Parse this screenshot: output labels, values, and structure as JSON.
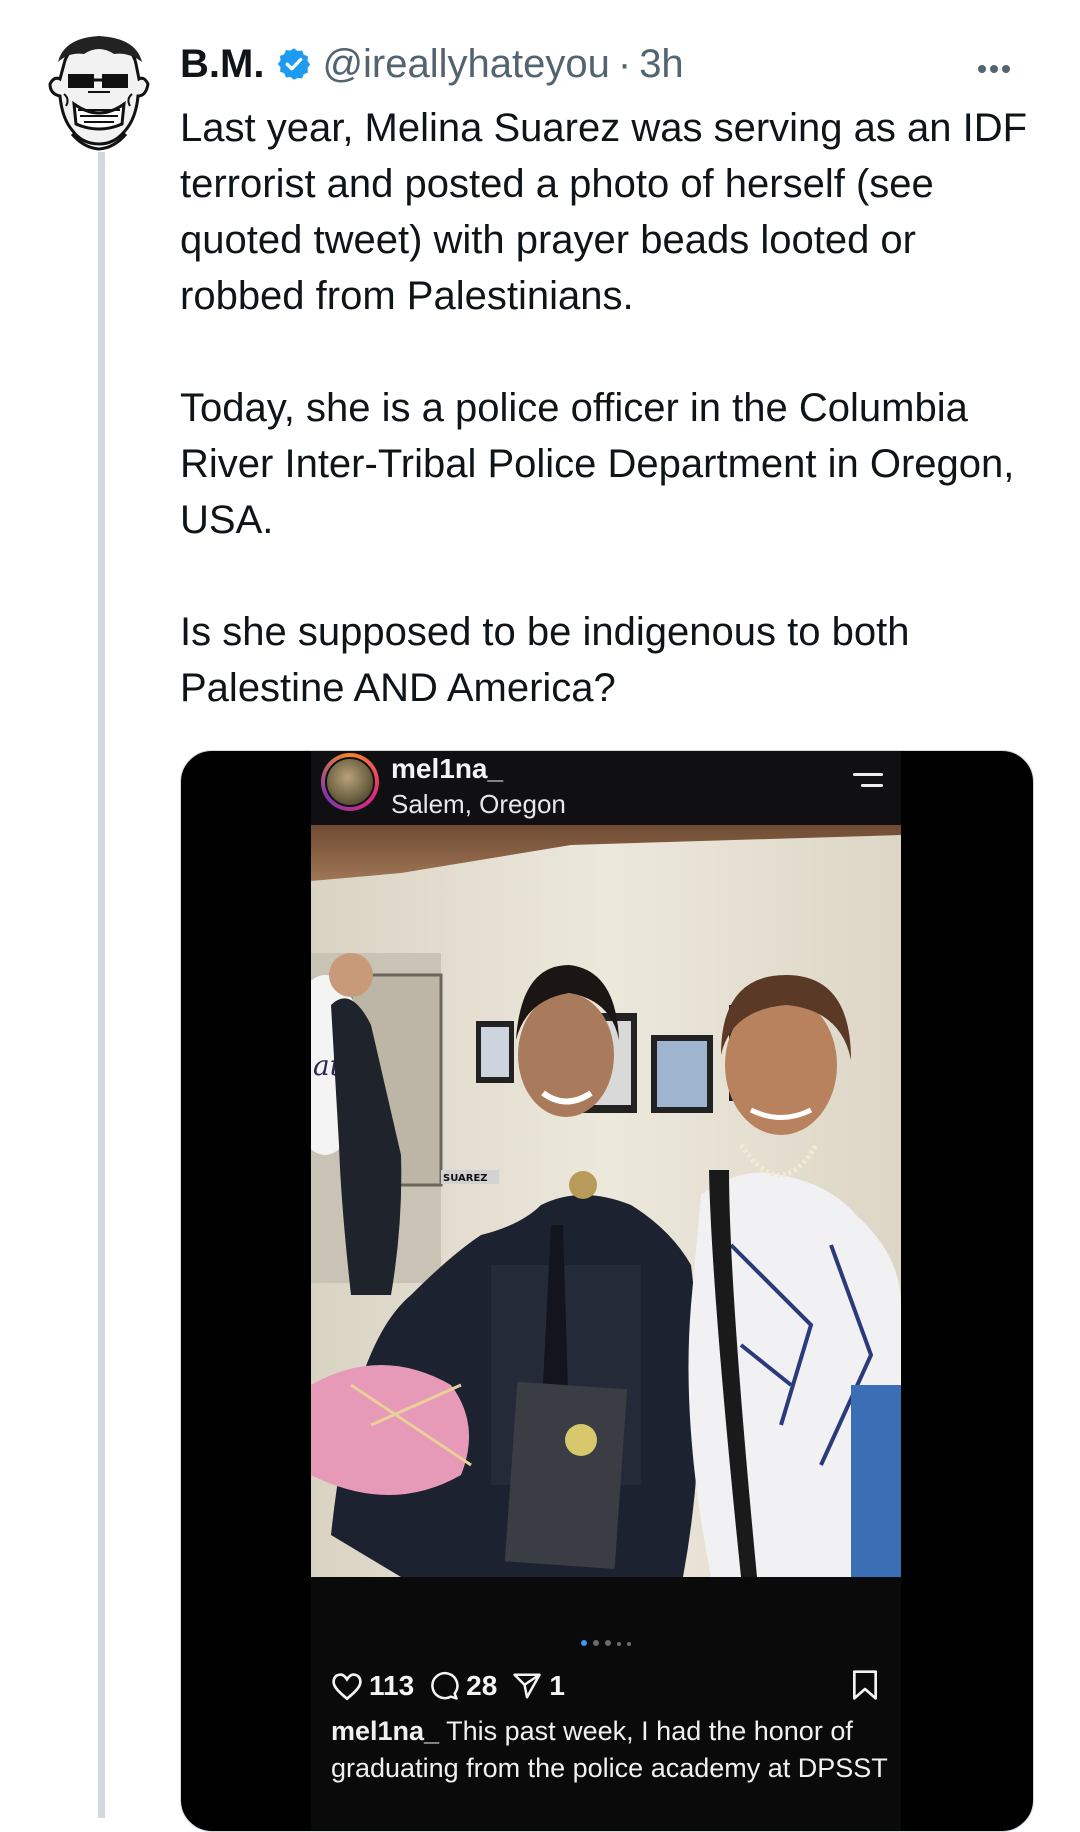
{
  "tweet": {
    "author_name": "B.M.",
    "handle": "@ireallyhateyou",
    "separator": "·",
    "time": "3h",
    "more_icon": "more-horizontal-icon",
    "verified_color": "#1d9bf0",
    "paragraphs": [
      "Last year, Melina Suarez was serving as an IDF terrorist and posted a photo of herself (see quoted tweet) with prayer beads looted or robbed from Palestinians.",
      "Today, she is a police officer in the Columbia River Inter-Tribal Police Department in Oregon, USA.",
      "Is she supposed to be indigenous to both Palestine AND America?"
    ]
  },
  "instagram": {
    "username": "mel1na_",
    "location": "Salem, Oregon",
    "likes": "113",
    "comments": "28",
    "shares": "1",
    "caption_user": "mel1na_",
    "caption_text": "This past week, I had the honor of graduating from the police academy at DPSST",
    "photo_nametag": "SUAREZ",
    "balloon_text": "ats"
  }
}
